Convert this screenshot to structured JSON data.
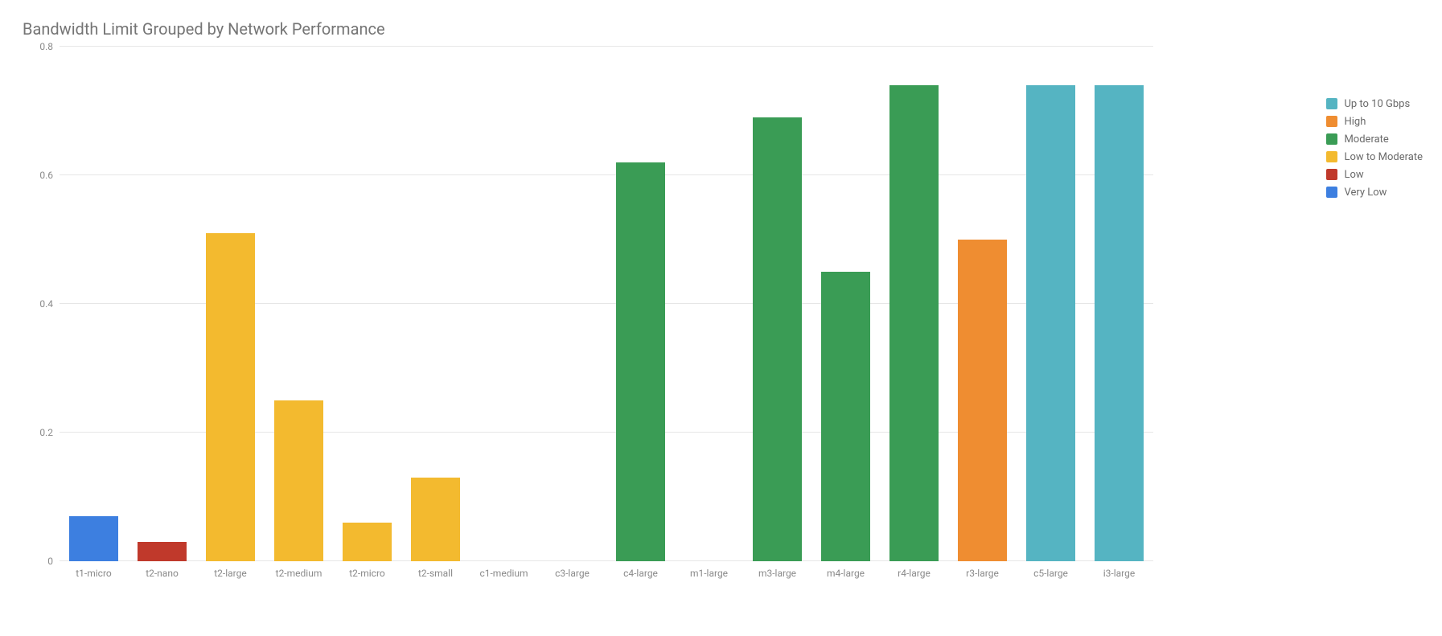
{
  "title": "Bandwidth Limit Grouped by Network Performance",
  "chart_data": {
    "type": "bar",
    "title": "Bandwidth Limit Grouped by Network Performance",
    "xlabel": "",
    "ylabel": "",
    "ylim": [
      0,
      0.8
    ],
    "yticks": [
      0,
      0.2,
      0.4,
      0.6,
      0.8
    ],
    "categories": [
      "t1-micro",
      "t2-nano",
      "t2-large",
      "t2-medium",
      "t2-micro",
      "t2-small",
      "c1-medium",
      "c3-large",
      "c4-large",
      "m1-large",
      "m3-large",
      "m4-large",
      "r4-large",
      "r3-large",
      "c5-large",
      "i3-large"
    ],
    "groups": [
      "Very Low",
      "Low",
      "Low to Moderate",
      "Low to Moderate",
      "Low to Moderate",
      "Low to Moderate",
      "Moderate",
      "Moderate",
      "Moderate",
      "Moderate",
      "Moderate",
      "Moderate",
      "Moderate",
      "High",
      "Up to 10 Gbps",
      "Up to 10 Gbps"
    ],
    "values": [
      0.07,
      0.03,
      0.51,
      0.25,
      0.06,
      0.13,
      0.0,
      0.0,
      0.62,
      0.0,
      0.69,
      0.45,
      0.74,
      0.5,
      0.74,
      0.74
    ],
    "group_colors": {
      "Up to 10 Gbps": "#55b4c2",
      "High": "#ef8d31",
      "Moderate": "#3a9c55",
      "Low to Moderate": "#f3ba2f",
      "Low": "#c0392b",
      "Very Low": "#3d7fe0"
    },
    "legend_order": [
      "Up to 10 Gbps",
      "High",
      "Moderate",
      "Low to Moderate",
      "Low",
      "Very Low"
    ]
  }
}
